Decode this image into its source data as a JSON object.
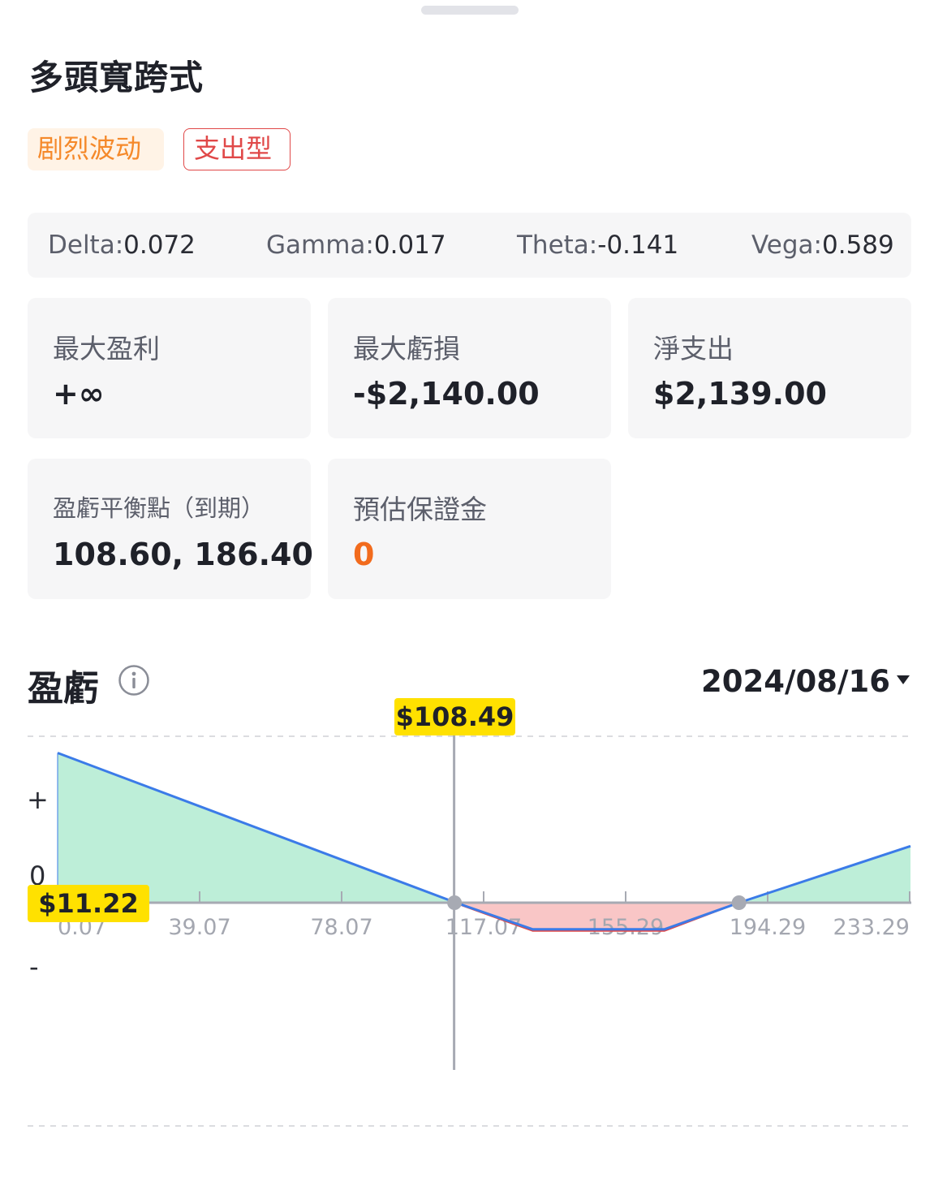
{
  "header": {
    "title": "多頭寬跨式",
    "tags": [
      {
        "label": "剧烈波动"
      },
      {
        "label": "支出型"
      }
    ]
  },
  "greeks": [
    {
      "name": "Delta:",
      "value": "0.072"
    },
    {
      "name": "Gamma:",
      "value": "0.017"
    },
    {
      "name": "Theta:",
      "value": "-0.141"
    },
    {
      "name": "Vega:",
      "value": "0.589"
    }
  ],
  "metrics": {
    "max_profit": {
      "label": "最大盈利",
      "value": "+∞"
    },
    "max_loss": {
      "label": "最大虧損",
      "value": "-$2,140.00"
    },
    "net_debit": {
      "label": "淨支出",
      "value": "$2,139.00"
    },
    "breakeven": {
      "label": "盈虧平衡點（到期）",
      "value": "108.60, 186.40"
    },
    "margin": {
      "label": "預估保證金",
      "value": "0"
    }
  },
  "pl_section": {
    "title": "盈虧",
    "date": "2024/08/16",
    "crosshair_x_label": "$108.49",
    "crosshair_y_label": "$11.22",
    "plus_sign": "+",
    "minus_sign": "-",
    "zero_label": "0"
  },
  "colors": {
    "profit_fill": "#bdeed8",
    "loss_fill": "#f9c6c6",
    "line": "#3b7be8",
    "loss_line": "#e04848",
    "badge": "#ffe100",
    "accent_orange": "#f26b1d"
  },
  "chart_data": {
    "type": "area",
    "title": "盈虧",
    "x_ticks": [
      "0.07",
      "39.07",
      "78.07",
      "117.07",
      "155.29",
      "194.29",
      "233.29"
    ],
    "x": [
      0.07,
      109,
      130,
      166,
      186.4,
      233.29
    ],
    "y": [
      45,
      0,
      -8,
      -8,
      0,
      17
    ],
    "xlim": [
      0.07,
      233.29
    ],
    "ylim": [
      -45,
      45
    ],
    "breakeven_points": [
      108.6,
      186.4
    ],
    "crosshair_x": 108.49
  }
}
